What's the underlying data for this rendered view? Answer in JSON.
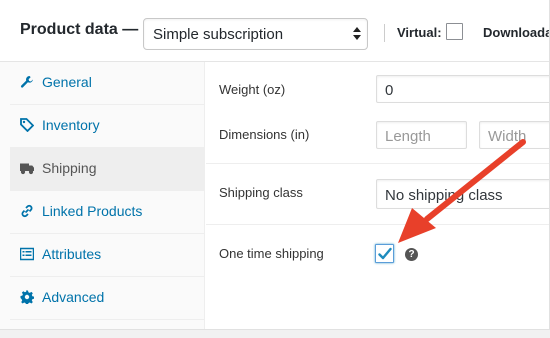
{
  "header": {
    "title": "Product data —",
    "product_type": "Simple subscription",
    "virtual_label": "Virtual:",
    "virtual_checked": false,
    "downloadable_label": "Downloada"
  },
  "sidebar": {
    "items": [
      {
        "label": "General",
        "icon": "wrench-icon",
        "active": false
      },
      {
        "label": "Inventory",
        "icon": "tag-icon",
        "active": false
      },
      {
        "label": "Shipping",
        "icon": "truck-icon",
        "active": true
      },
      {
        "label": "Linked Products",
        "icon": "link-icon",
        "active": false
      },
      {
        "label": "Attributes",
        "icon": "list-icon",
        "active": false
      },
      {
        "label": "Advanced",
        "icon": "gear-icon",
        "active": false
      }
    ]
  },
  "shipping": {
    "weight_label": "Weight (oz)",
    "weight_value": "0",
    "dimensions_label": "Dimensions (in)",
    "length_placeholder": "Length",
    "width_placeholder": "Width",
    "shipping_class_label": "Shipping class",
    "shipping_class_value": "No shipping class",
    "one_time_label": "One time shipping",
    "one_time_checked": true,
    "help_glyph": "?"
  },
  "colors": {
    "link": "#0073aa",
    "checkbox_check": "#1e8cbe",
    "annotation_arrow": "#e8402a"
  }
}
